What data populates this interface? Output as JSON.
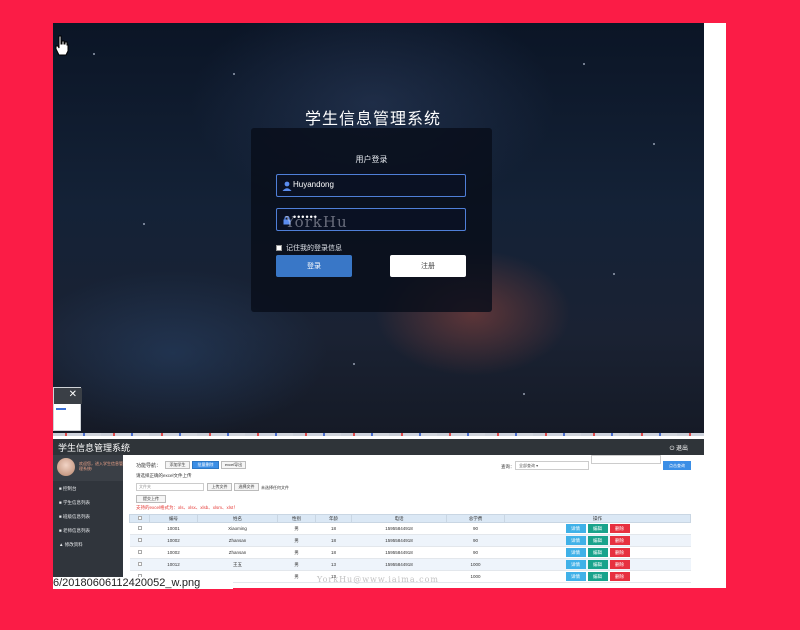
{
  "login": {
    "system_title": "学生信息管理系统",
    "panel_title": "用户登录",
    "username_value": "Huyandong",
    "password_mask": "••••••",
    "watermark": "YorkHu",
    "remember_label": "记住我的登录信息",
    "login_button": "登录",
    "register_button": "注册"
  },
  "admin": {
    "title": "学生信息管理系统",
    "logout": "⏻ 退出",
    "welcome": "欢迎您，进入学生信息管理系统!",
    "nav": [
      "控制台",
      "学生信息列表",
      "班级信息列表",
      "老师信息列表",
      "修改资料"
    ],
    "toolbar_label": "功能导航：",
    "add_button": "添加学生",
    "batch_delete_button": "批量删除",
    "export_button": "excel导出",
    "import_hint": "请选择正确的excel文件上传",
    "file_placeholder": "文件夹",
    "upload_file_button": "上传文件",
    "choose_file_button": "选择文件",
    "no_file_text": "未选择任何文件",
    "submit_upload_button": "提交上传",
    "format_hint": "支持的excel格式为：xls、xlsx、xlsb、xlsm、xlst！",
    "search_label": "查询：",
    "search_select": "全部查询",
    "search_button": "点击查询",
    "watermark": "YorkHu@www.iaima.com",
    "columns": [
      "",
      "编号",
      "姓名",
      "性别",
      "年龄",
      "电话",
      "总学费",
      "操作"
    ],
    "rows": [
      {
        "id": "10001",
        "name": "Xiaoming",
        "gender": "男",
        "age": "18",
        "phone": "15955844918",
        "fee": "90"
      },
      {
        "id": "10002",
        "name": "Zhansan",
        "gender": "男",
        "age": "18",
        "phone": "15955844918",
        "fee": "90"
      },
      {
        "id": "10002",
        "name": "Zhansan",
        "gender": "男",
        "age": "18",
        "phone": "15955844918",
        "fee": "90"
      },
      {
        "id": "10012",
        "name": "王五",
        "gender": "男",
        "age": "13",
        "phone": "15955844918",
        "fee": "1000"
      },
      {
        "id": "",
        "name": "",
        "gender": "男",
        "age": "13",
        "phone": "",
        "fee": "1000"
      }
    ],
    "action_detail": "详情",
    "action_edit": "编辑",
    "action_delete": "删除"
  },
  "caption": "6/20180606112420052_w.png"
}
